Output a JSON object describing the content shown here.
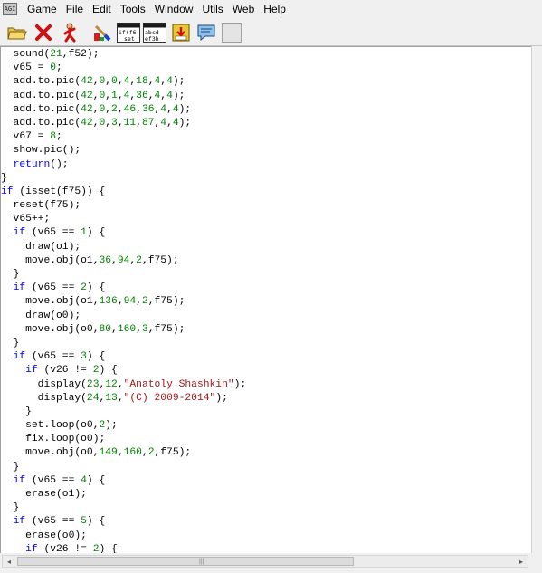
{
  "menubar": {
    "app_icon_text": "AGI",
    "items": [
      {
        "label": "Game",
        "accel": "G",
        "rest": "ame"
      },
      {
        "label": "File",
        "accel": "F",
        "rest": "ile"
      },
      {
        "label": "Edit",
        "accel": "E",
        "rest": "dit"
      },
      {
        "label": "Tools",
        "accel": "T",
        "rest": "ools"
      },
      {
        "label": "Window",
        "accel": "W",
        "rest": "indow"
      },
      {
        "label": "Utils",
        "accel": "U",
        "rest": "tils"
      },
      {
        "label": "Web",
        "accel": "W",
        "rest": "eb"
      },
      {
        "label": "Help",
        "accel": "H",
        "rest": "elp"
      }
    ]
  },
  "toolbar": {
    "icons": [
      "open-folder-icon",
      "close-x-icon",
      "running-man-icon",
      "paint-icon",
      "logic-view-icon",
      "text-view-icon",
      "save-icon",
      "speech-bubble-icon",
      "blank-icon"
    ],
    "logic_icon_text": [
      "if(f6",
      "set"
    ],
    "text_icon_text": [
      "abcd",
      "ef3h"
    ]
  },
  "code": {
    "lines": [
      [
        {
          "t": "  sound(",
          "c": ""
        },
        {
          "t": "21",
          "c": "num"
        },
        {
          "t": ",f52);",
          "c": ""
        }
      ],
      [
        {
          "t": "  v65 = ",
          "c": ""
        },
        {
          "t": "0",
          "c": "num"
        },
        {
          "t": ";",
          "c": ""
        }
      ],
      [
        {
          "t": "  add.to.pic(",
          "c": ""
        },
        {
          "t": "42",
          "c": "num"
        },
        {
          "t": ",",
          "c": ""
        },
        {
          "t": "0",
          "c": "num"
        },
        {
          "t": ",",
          "c": ""
        },
        {
          "t": "0",
          "c": "num"
        },
        {
          "t": ",",
          "c": ""
        },
        {
          "t": "4",
          "c": "num"
        },
        {
          "t": ",",
          "c": ""
        },
        {
          "t": "18",
          "c": "num"
        },
        {
          "t": ",",
          "c": ""
        },
        {
          "t": "4",
          "c": "num"
        },
        {
          "t": ",",
          "c": ""
        },
        {
          "t": "4",
          "c": "num"
        },
        {
          "t": ");",
          "c": ""
        }
      ],
      [
        {
          "t": "  add.to.pic(",
          "c": ""
        },
        {
          "t": "42",
          "c": "num"
        },
        {
          "t": ",",
          "c": ""
        },
        {
          "t": "0",
          "c": "num"
        },
        {
          "t": ",",
          "c": ""
        },
        {
          "t": "1",
          "c": "num"
        },
        {
          "t": ",",
          "c": ""
        },
        {
          "t": "4",
          "c": "num"
        },
        {
          "t": ",",
          "c": ""
        },
        {
          "t": "36",
          "c": "num"
        },
        {
          "t": ",",
          "c": ""
        },
        {
          "t": "4",
          "c": "num"
        },
        {
          "t": ",",
          "c": ""
        },
        {
          "t": "4",
          "c": "num"
        },
        {
          "t": ");",
          "c": ""
        }
      ],
      [
        {
          "t": "  add.to.pic(",
          "c": ""
        },
        {
          "t": "42",
          "c": "num"
        },
        {
          "t": ",",
          "c": ""
        },
        {
          "t": "0",
          "c": "num"
        },
        {
          "t": ",",
          "c": ""
        },
        {
          "t": "2",
          "c": "num"
        },
        {
          "t": ",",
          "c": ""
        },
        {
          "t": "46",
          "c": "num"
        },
        {
          "t": ",",
          "c": ""
        },
        {
          "t": "36",
          "c": "num"
        },
        {
          "t": ",",
          "c": ""
        },
        {
          "t": "4",
          "c": "num"
        },
        {
          "t": ",",
          "c": ""
        },
        {
          "t": "4",
          "c": "num"
        },
        {
          "t": ");",
          "c": ""
        }
      ],
      [
        {
          "t": "  add.to.pic(",
          "c": ""
        },
        {
          "t": "42",
          "c": "num"
        },
        {
          "t": ",",
          "c": ""
        },
        {
          "t": "0",
          "c": "num"
        },
        {
          "t": ",",
          "c": ""
        },
        {
          "t": "3",
          "c": "num"
        },
        {
          "t": ",",
          "c": ""
        },
        {
          "t": "11",
          "c": "num"
        },
        {
          "t": ",",
          "c": ""
        },
        {
          "t": "87",
          "c": "num"
        },
        {
          "t": ",",
          "c": ""
        },
        {
          "t": "4",
          "c": "num"
        },
        {
          "t": ",",
          "c": ""
        },
        {
          "t": "4",
          "c": "num"
        },
        {
          "t": ");",
          "c": ""
        }
      ],
      [
        {
          "t": "  v67 = ",
          "c": ""
        },
        {
          "t": "8",
          "c": "num"
        },
        {
          "t": ";",
          "c": ""
        }
      ],
      [
        {
          "t": "  show.pic();",
          "c": ""
        }
      ],
      [
        {
          "t": "  ",
          "c": ""
        },
        {
          "t": "return",
          "c": "kw"
        },
        {
          "t": "();",
          "c": ""
        }
      ],
      [
        {
          "t": "}",
          "c": ""
        }
      ],
      [
        {
          "t": "if",
          "c": "kw"
        },
        {
          "t": " (isset(f75)) {",
          "c": ""
        }
      ],
      [
        {
          "t": "  reset(f75);",
          "c": ""
        }
      ],
      [
        {
          "t": "  v65++;",
          "c": ""
        }
      ],
      [
        {
          "t": "  ",
          "c": ""
        },
        {
          "t": "if",
          "c": "kw"
        },
        {
          "t": " (v65 == ",
          "c": ""
        },
        {
          "t": "1",
          "c": "num"
        },
        {
          "t": ") {",
          "c": ""
        }
      ],
      [
        {
          "t": "    draw(o1);",
          "c": ""
        }
      ],
      [
        {
          "t": "    move.obj(o1,",
          "c": ""
        },
        {
          "t": "36",
          "c": "num"
        },
        {
          "t": ",",
          "c": ""
        },
        {
          "t": "94",
          "c": "num"
        },
        {
          "t": ",",
          "c": ""
        },
        {
          "t": "2",
          "c": "num"
        },
        {
          "t": ",f75);",
          "c": ""
        }
      ],
      [
        {
          "t": "  }",
          "c": ""
        }
      ],
      [
        {
          "t": "  ",
          "c": ""
        },
        {
          "t": "if",
          "c": "kw"
        },
        {
          "t": " (v65 == ",
          "c": ""
        },
        {
          "t": "2",
          "c": "num"
        },
        {
          "t": ") {",
          "c": ""
        }
      ],
      [
        {
          "t": "    move.obj(o1,",
          "c": ""
        },
        {
          "t": "136",
          "c": "num"
        },
        {
          "t": ",",
          "c": ""
        },
        {
          "t": "94",
          "c": "num"
        },
        {
          "t": ",",
          "c": ""
        },
        {
          "t": "2",
          "c": "num"
        },
        {
          "t": ",f75);",
          "c": ""
        }
      ],
      [
        {
          "t": "    draw(o0);",
          "c": ""
        }
      ],
      [
        {
          "t": "    move.obj(o0,",
          "c": ""
        },
        {
          "t": "80",
          "c": "num"
        },
        {
          "t": ",",
          "c": ""
        },
        {
          "t": "160",
          "c": "num"
        },
        {
          "t": ",",
          "c": ""
        },
        {
          "t": "3",
          "c": "num"
        },
        {
          "t": ",f75);",
          "c": ""
        }
      ],
      [
        {
          "t": "  }",
          "c": ""
        }
      ],
      [
        {
          "t": "  ",
          "c": ""
        },
        {
          "t": "if",
          "c": "kw"
        },
        {
          "t": " (v65 == ",
          "c": ""
        },
        {
          "t": "3",
          "c": "num"
        },
        {
          "t": ") {",
          "c": ""
        }
      ],
      [
        {
          "t": "    ",
          "c": ""
        },
        {
          "t": "if",
          "c": "kw"
        },
        {
          "t": " (v26 != ",
          "c": ""
        },
        {
          "t": "2",
          "c": "num"
        },
        {
          "t": ") {",
          "c": ""
        }
      ],
      [
        {
          "t": "      display(",
          "c": ""
        },
        {
          "t": "23",
          "c": "num"
        },
        {
          "t": ",",
          "c": ""
        },
        {
          "t": "12",
          "c": "num"
        },
        {
          "t": ",",
          "c": ""
        },
        {
          "t": "\"Anatoly Shashkin\"",
          "c": "str"
        },
        {
          "t": ");",
          "c": ""
        }
      ],
      [
        {
          "t": "      display(",
          "c": ""
        },
        {
          "t": "24",
          "c": "num"
        },
        {
          "t": ",",
          "c": ""
        },
        {
          "t": "13",
          "c": "num"
        },
        {
          "t": ",",
          "c": ""
        },
        {
          "t": "\"(C) 2009-2014\"",
          "c": "str"
        },
        {
          "t": ");",
          "c": ""
        }
      ],
      [
        {
          "t": "    }",
          "c": ""
        }
      ],
      [
        {
          "t": "    set.loop(o0,",
          "c": ""
        },
        {
          "t": "2",
          "c": "num"
        },
        {
          "t": ");",
          "c": ""
        }
      ],
      [
        {
          "t": "    fix.loop(o0);",
          "c": ""
        }
      ],
      [
        {
          "t": "    move.obj(o0,",
          "c": ""
        },
        {
          "t": "149",
          "c": "num"
        },
        {
          "t": ",",
          "c": ""
        },
        {
          "t": "160",
          "c": "num"
        },
        {
          "t": ",",
          "c": ""
        },
        {
          "t": "2",
          "c": "num"
        },
        {
          "t": ",f75);",
          "c": ""
        }
      ],
      [
        {
          "t": "  }",
          "c": ""
        }
      ],
      [
        {
          "t": "  ",
          "c": ""
        },
        {
          "t": "if",
          "c": "kw"
        },
        {
          "t": " (v65 == ",
          "c": ""
        },
        {
          "t": "4",
          "c": "num"
        },
        {
          "t": ") {",
          "c": ""
        }
      ],
      [
        {
          "t": "    erase(o1);",
          "c": ""
        }
      ],
      [
        {
          "t": "  }",
          "c": ""
        }
      ],
      [
        {
          "t": "  ",
          "c": ""
        },
        {
          "t": "if",
          "c": "kw"
        },
        {
          "t": " (v65 == ",
          "c": ""
        },
        {
          "t": "5",
          "c": "num"
        },
        {
          "t": ") {",
          "c": ""
        }
      ],
      [
        {
          "t": "    erase(o0);",
          "c": ""
        }
      ],
      [
        {
          "t": "    ",
          "c": ""
        },
        {
          "t": "if",
          "c": "kw"
        },
        {
          "t": " (v26 != ",
          "c": ""
        },
        {
          "t": "2",
          "c": "num"
        },
        {
          "t": ") {",
          "c": ""
        }
      ]
    ]
  },
  "colors": {
    "keyword": "#0000ff",
    "number": "#008000",
    "string": "#a31515"
  }
}
